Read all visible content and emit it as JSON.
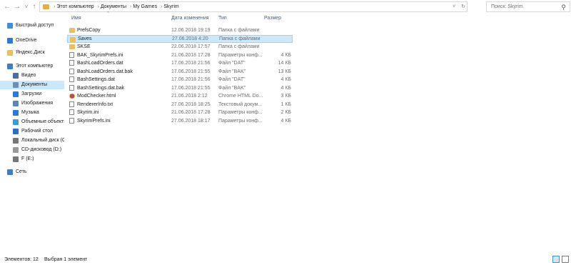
{
  "nav_buttons": {
    "back": "←",
    "forward": "→",
    "recent": "˅",
    "up": "↑"
  },
  "address": {
    "crumbs": [
      "Этот компьютер",
      "Документы",
      "My Games",
      "Skyrim"
    ],
    "separator": "›",
    "dropdown": "˅",
    "refresh": "↻"
  },
  "search": {
    "placeholder": "Поиск: Skyrim",
    "icon": "search-icon"
  },
  "nav_pane": [
    {
      "label": "Быстрый доступ",
      "icon": "star-icon",
      "color": "#3c8ee0"
    },
    {
      "label": "OneDrive",
      "icon": "cloud-icon",
      "color": "#2b79d8"
    },
    {
      "label": "Яндекс.Диск",
      "icon": "folder-icon",
      "color": "#e8c15c"
    },
    {
      "label": "Этот компьютер",
      "icon": "computer-icon",
      "color": "#3a7fc9"
    },
    {
      "label": "Видео",
      "icon": "video-icon",
      "color": "#4a6f9c"
    },
    {
      "label": "Документы",
      "icon": "documents-icon",
      "color": "#6b8fb8",
      "selected": true
    },
    {
      "label": "Загрузки",
      "icon": "download-icon",
      "color": "#2b79d8"
    },
    {
      "label": "Изображения",
      "icon": "pictures-icon",
      "color": "#5a86b8"
    },
    {
      "label": "Музыка",
      "icon": "music-icon",
      "color": "#2b79d8"
    },
    {
      "label": "Объемные объекты",
      "icon": "3d-objects-icon",
      "color": "#3b9bd8"
    },
    {
      "label": "Рабочий стол",
      "icon": "desktop-icon",
      "color": "#2b6fc0"
    },
    {
      "label": "Локальный диск (C:)",
      "icon": "drive-icon",
      "color": "#777777"
    },
    {
      "label": "CD-дисковод (D:)",
      "icon": "cd-icon",
      "color": "#999999"
    },
    {
      "label": "F (E:)",
      "icon": "usb-drive-icon",
      "color": "#777777"
    },
    {
      "label": "Сеть",
      "icon": "network-icon",
      "color": "#3a7fc9"
    }
  ],
  "columns": {
    "name": "Имя",
    "date": "Дата изменения",
    "type": "Тип",
    "size": "Размер",
    "sort_indicator": "^"
  },
  "files": [
    {
      "name": "PrefsCopy",
      "date": "12.06.2018 19:19",
      "type": "Папка с файлами",
      "size": "",
      "icon": "folder"
    },
    {
      "name": "Saves",
      "date": "27.06.2018 4:20",
      "type": "Папка с файлами",
      "size": "",
      "icon": "folder",
      "selected": true
    },
    {
      "name": "SKSE",
      "date": "22.06.2018 17:57",
      "type": "Папка с файлами",
      "size": "",
      "icon": "folder"
    },
    {
      "name": "BAK_SkyrimPrefs.ini",
      "date": "21.06.2018 17:28",
      "type": "Параметры конф...",
      "size": "4 КБ",
      "icon": "file"
    },
    {
      "name": "BashLoadOrders.dat",
      "date": "17.06.2018 21:56",
      "type": "Файл \"DAT\"",
      "size": "14 КБ",
      "icon": "file"
    },
    {
      "name": "BashLoadOrders.dat.bak",
      "date": "17.06.2018 21:55",
      "type": "Файл \"BAK\"",
      "size": "13 КБ",
      "icon": "file"
    },
    {
      "name": "BashSettings.dat",
      "date": "17.06.2018 21:56",
      "type": "Файл \"DAT\"",
      "size": "4 КБ",
      "icon": "file"
    },
    {
      "name": "BashSettings.dat.bak",
      "date": "17.06.2018 21:55",
      "type": "Файл \"BAK\"",
      "size": "4 КБ",
      "icon": "file"
    },
    {
      "name": "ModChecker.html",
      "date": "21.06.2018 2:12",
      "type": "Chrome HTML Do...",
      "size": "3 КБ",
      "icon": "html"
    },
    {
      "name": "RendererInfo.txt",
      "date": "27.06.2018 18:25",
      "type": "Текстовый докум...",
      "size": "1 КБ",
      "icon": "file"
    },
    {
      "name": "Skyrim.ini",
      "date": "21.06.2018 17:28",
      "type": "Параметры конф...",
      "size": "2 КБ",
      "icon": "file"
    },
    {
      "name": "SkyrimPrefs.ini",
      "date": "27.06.2018 18:17",
      "type": "Параметры конф...",
      "size": "4 КБ",
      "icon": "file"
    }
  ],
  "status": {
    "count": "Элементов: 12",
    "selection": "Выбран 1 элемент"
  },
  "view_buttons": [
    "details-view-icon",
    "large-icons-view-icon"
  ]
}
